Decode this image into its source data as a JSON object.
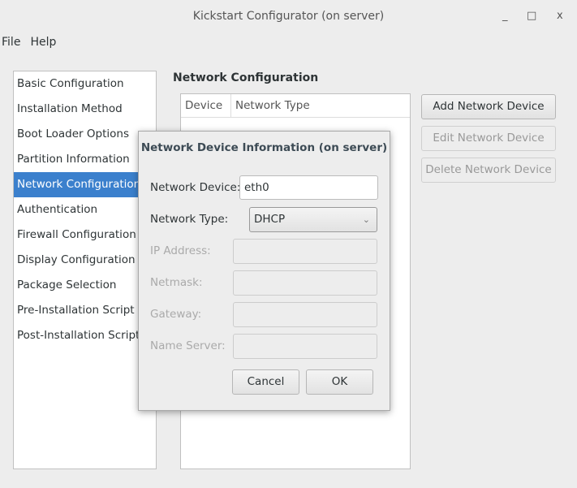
{
  "window": {
    "title": "Kickstart Configurator (on server)",
    "minimize": "_",
    "maximize": "□",
    "close": "x"
  },
  "menu": [
    "File",
    "Help"
  ],
  "sidebar": {
    "selected": "Network Configuration",
    "items": [
      "Basic Configuration",
      "Installation Method",
      "Boot Loader Options",
      "Partition Information",
      "Network Configuration",
      "Authentication",
      "Firewall Configuration",
      "Display Configuration",
      "Package Selection",
      "Pre-Installation Script",
      "Post-Installation Script"
    ]
  },
  "main": {
    "heading": "Network Configuration",
    "columns": [
      "Device",
      "Network Type"
    ],
    "buttons": {
      "add": "Add Network Device",
      "edit": "Edit Network Device",
      "delete": "Delete Network Device"
    }
  },
  "dialog": {
    "title": "Network Device Information (on server)",
    "device_label": "Network Device:",
    "device_value": "eth0",
    "type_label": "Network Type:",
    "type_value": "DHCP",
    "ip_label": "IP Address:",
    "netmask_label": "Netmask:",
    "gateway_label": "Gateway:",
    "nameserver_label": "Name Server:",
    "cancel": "Cancel",
    "ok": "OK"
  },
  "colors": {
    "selection": "#3b80cd"
  }
}
